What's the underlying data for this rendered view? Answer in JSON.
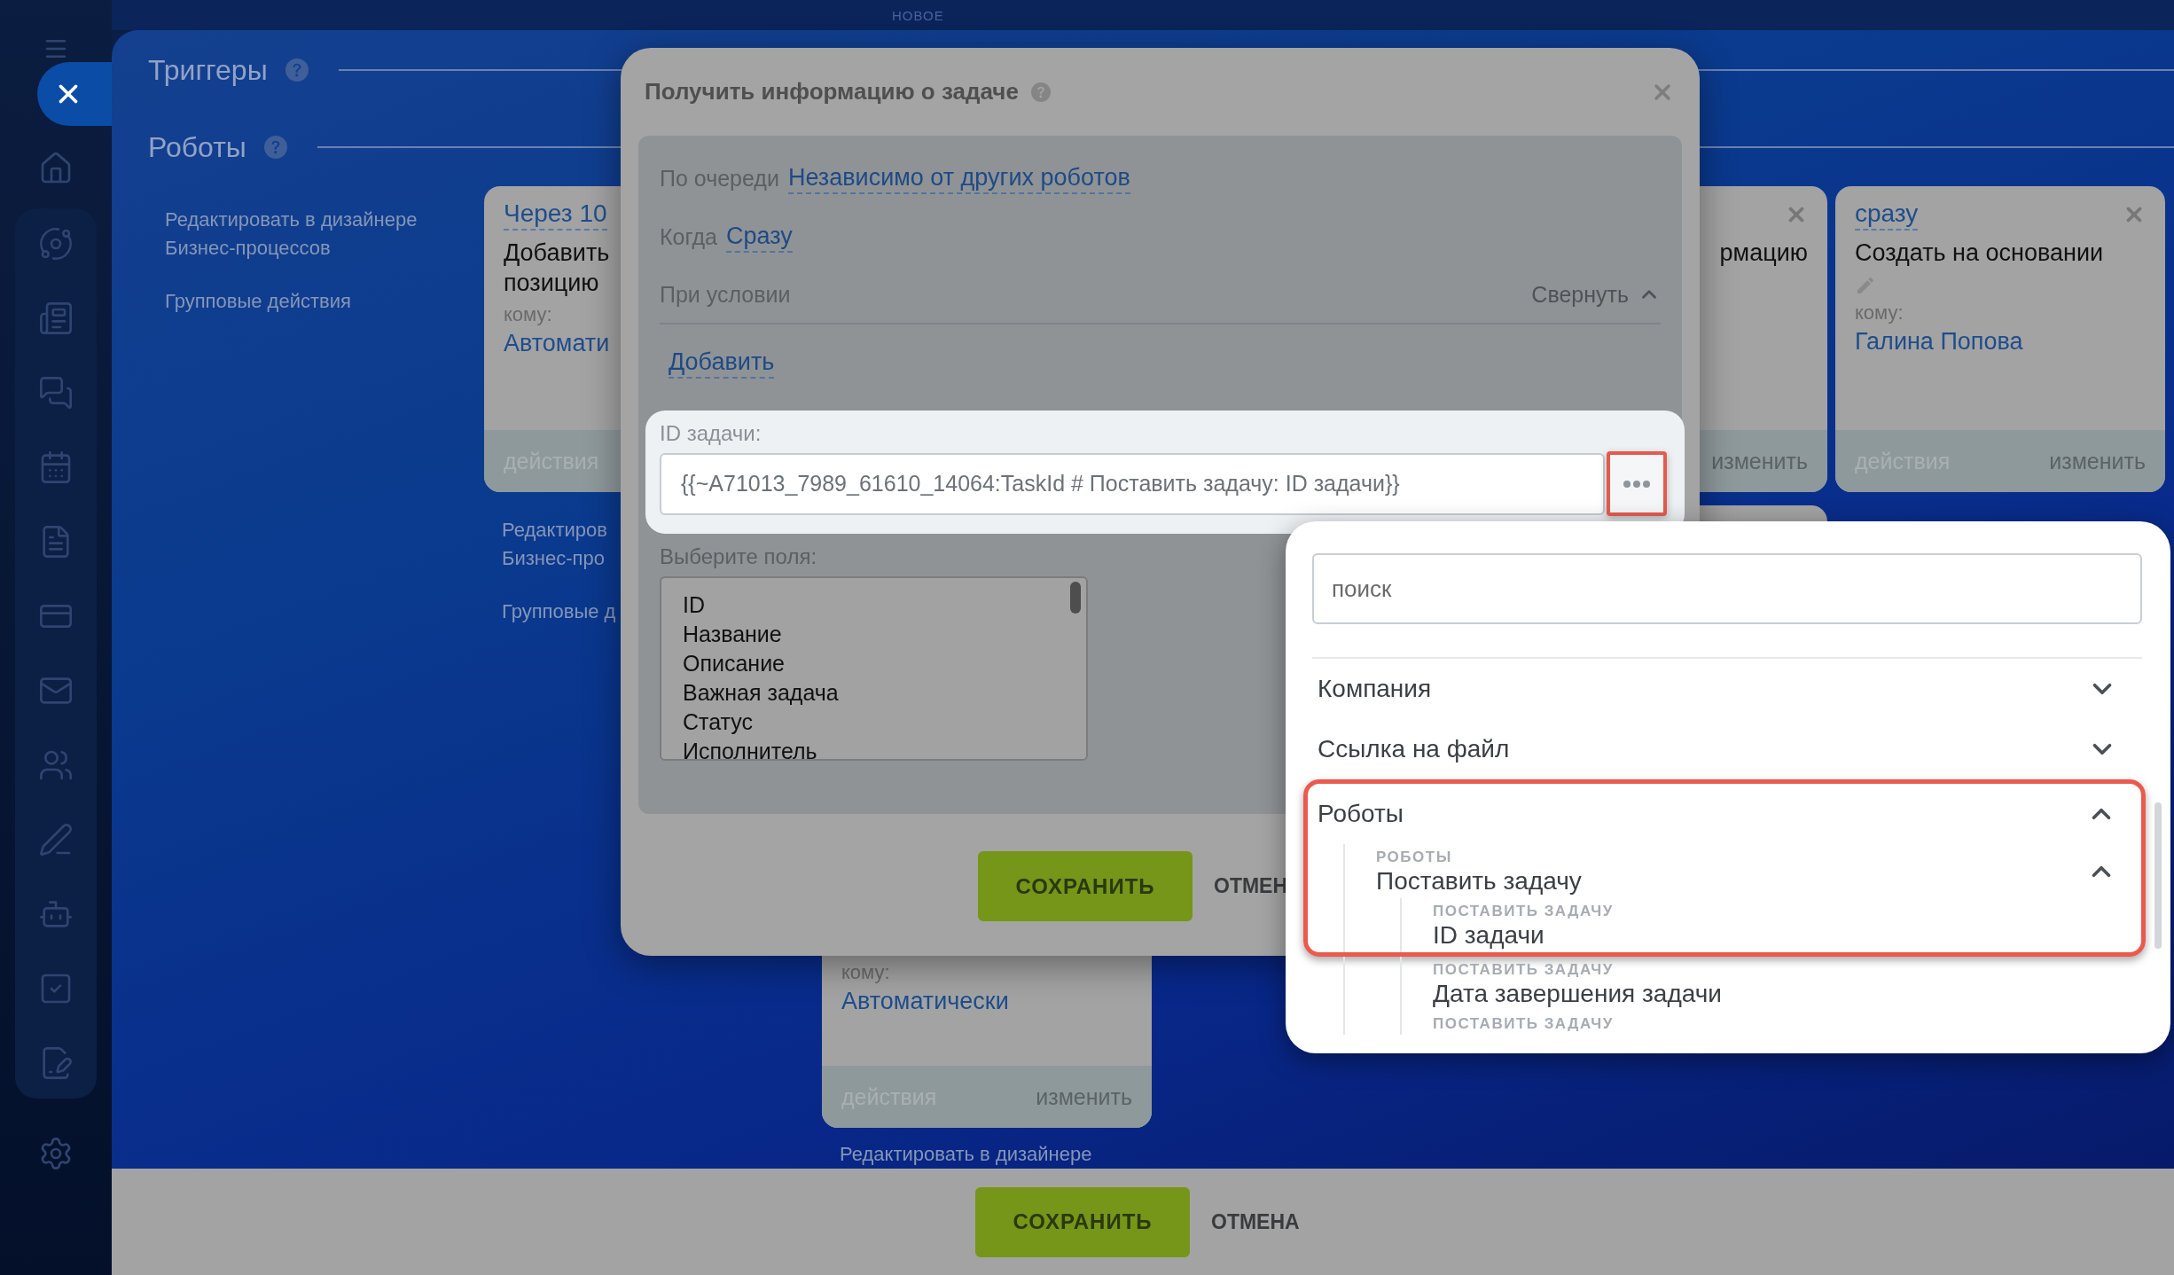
{
  "top_label": "НОВОЕ",
  "sections": [
    {
      "title": "Триггеры"
    },
    {
      "title": "Роботы"
    }
  ],
  "robots": {
    "columns": [
      {
        "links": [
          "Редактировать в дизайнере\nБизнес-процессов",
          "Групповые действия"
        ]
      },
      {
        "cards": [
          {
            "kind": "card",
            "delay": "Через 10",
            "title": "Добавить позицию",
            "recipient_label": "кому:",
            "recipient": "Автомати",
            "footer_left": "действия"
          }
        ],
        "links": [
          "Редактиров\nБизнес-про",
          "Групповые д"
        ]
      },
      {
        "cards": [
          {
            "kind": "card",
            "recipient_label": "кому:",
            "recipient": "Автоматически",
            "footer_left": "действия",
            "footer_right": "изменить"
          }
        ],
        "links": [
          "Редактировать в дизайнере"
        ]
      },
      {},
      {
        "cards": [
          {
            "kind": "partial",
            "closable": true,
            "title": "рмацию",
            "footer_right": "изменить"
          },
          {
            "kind": "stub"
          }
        ]
      },
      {
        "cards": [
          {
            "kind": "card",
            "closable": true,
            "editable": true,
            "delay": "сразу",
            "title": "Создать на основании",
            "recipient_label": "кому:",
            "recipient": "Галина Попова",
            "footer_left": "действия",
            "footer_right": "изменить"
          }
        ]
      }
    ]
  },
  "modal": {
    "title": "Получить информацию о задаче",
    "rows": [
      {
        "kind": "choice",
        "label": "По очереди",
        "value": "Независимо от других роботов"
      },
      {
        "kind": "choice",
        "label": "Когда",
        "value": "Сразу"
      },
      {
        "kind": "section",
        "label": "При условии",
        "action": "Свернуть",
        "expanded": true
      },
      {
        "kind": "add",
        "value": "Добавить"
      }
    ],
    "id_field": {
      "label": "ID задачи:",
      "value": "{{~A71013_7989_61610_14064:TaskId # Поставить задачу: ID задачи}}",
      "highlighted": true
    },
    "fields_select": {
      "label": "Выберите поля:",
      "options": [
        "ID",
        "Название",
        "Описание",
        "Важная задача",
        "Статус",
        "Исполнитель"
      ]
    },
    "save": "СОХРАНИТЬ",
    "cancel": "ОТМЕН"
  },
  "dropdown": {
    "search": {
      "placeholder": "поиск"
    },
    "items": [
      {
        "label": "Компания",
        "expanded": false
      },
      {
        "label": "Ссылка на файл",
        "expanded": false
      },
      {
        "label": "Роботы",
        "expanded": true,
        "highlighted": true,
        "children": [
          {
            "caption": "РОБОТЫ",
            "label": "Поставить задачу",
            "expanded": true,
            "highlighted": true,
            "children": [
              {
                "caption": "ПОСТАВИТЬ ЗАДАЧУ",
                "label": "ID задачи",
                "highlighted": true
              },
              {
                "caption": "ПОСТАВИТЬ ЗАДАЧУ",
                "label": "Дата завершения задачи",
                "highlighted": false
              },
              {
                "caption": "ПОСТАВИТЬ ЗАДАЧУ",
                "highlighted": false
              }
            ]
          }
        ]
      }
    ]
  },
  "footer": {
    "save": "СОХРАНИТЬ",
    "cancel": "ОТМЕНА"
  }
}
